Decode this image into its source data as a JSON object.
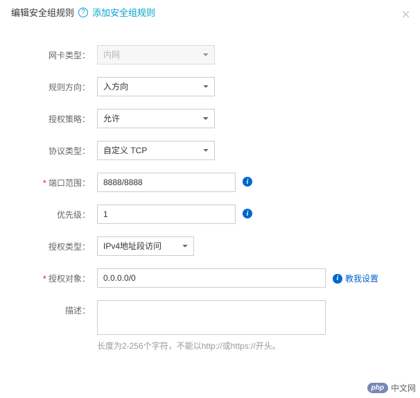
{
  "header": {
    "title": "编辑安全组规则",
    "add_rule_link": "添加安全组规则"
  },
  "form": {
    "nic_type": {
      "label": "网卡类型：",
      "value": "内网"
    },
    "direction": {
      "label": "规则方向：",
      "value": "入方向"
    },
    "policy": {
      "label": "授权策略：",
      "value": "允许"
    },
    "protocol": {
      "label": "协议类型：",
      "value": "自定义 TCP"
    },
    "port_range": {
      "label": "端口范围：",
      "value": "8888/8888"
    },
    "priority": {
      "label": "优先级：",
      "value": "1"
    },
    "auth_type": {
      "label": "授权类型：",
      "value": "IPv4地址段访问"
    },
    "auth_object": {
      "label": "授权对象：",
      "value": "0.0.0.0/0",
      "help_link": "教我设置"
    },
    "description": {
      "label": "描述：",
      "value": "",
      "hint": "长度为2-256个字符，不能以http://或https://开头。"
    }
  },
  "watermark": {
    "badge": "php",
    "text": "中文网"
  }
}
